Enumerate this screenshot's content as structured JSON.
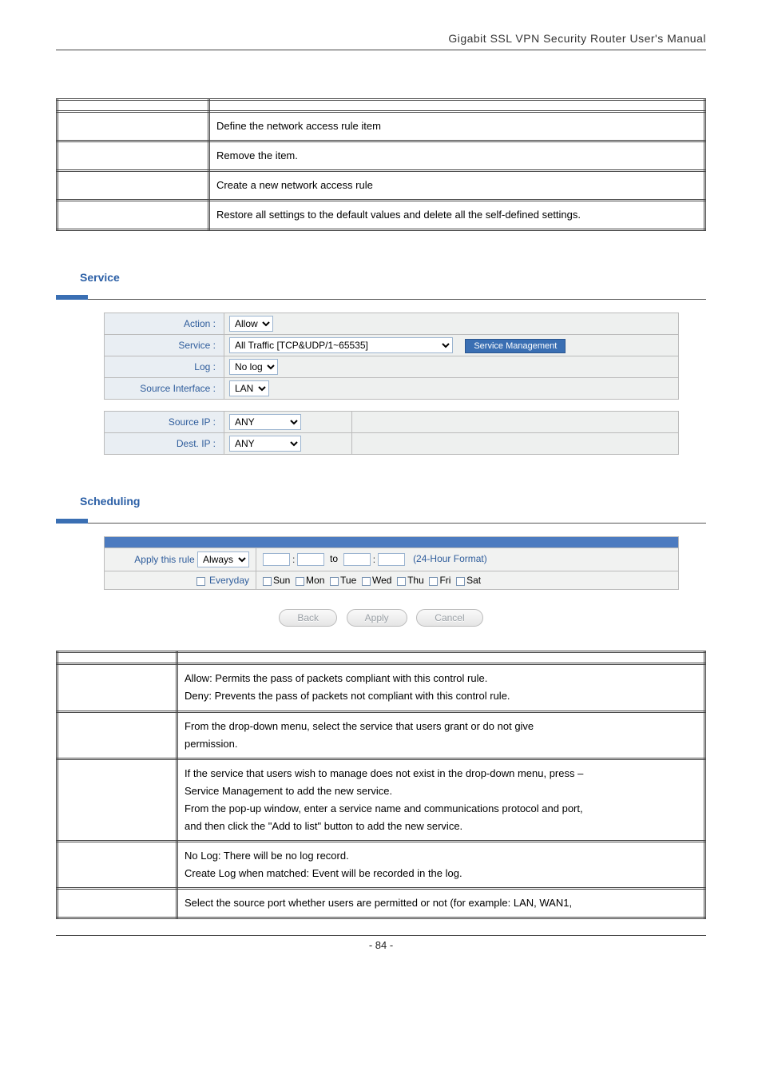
{
  "header": {
    "title": "Gigabit SSL VPN Security Router User's Manual"
  },
  "table1": {
    "rows": [
      {
        "label": "",
        "desc": "Define the network access rule item"
      },
      {
        "label": "",
        "desc": "Remove the item."
      },
      {
        "label": "",
        "desc": "Create a new network access rule"
      },
      {
        "label": "",
        "desc": "Restore all settings to the default values and delete all the self-defined settings."
      }
    ]
  },
  "service": {
    "title": "Service",
    "rows": {
      "action": {
        "label": "Action :",
        "value": "Allow"
      },
      "service": {
        "label": "Service :",
        "value": "All Traffic [TCP&UDP/1~65535]",
        "button": "Service Management"
      },
      "log": {
        "label": "Log :",
        "value": "No log"
      },
      "src_if": {
        "label": "Source Interface :",
        "value": "LAN"
      },
      "src_ip": {
        "label": "Source IP :",
        "value": "ANY"
      },
      "dest_ip": {
        "label": "Dest. IP :",
        "value": "ANY"
      }
    }
  },
  "scheduling": {
    "title": "Scheduling",
    "apply_label": "Apply this rule",
    "apply_value": "Always",
    "to": "to",
    "format_note": "(24-Hour Format)",
    "everyday": "Everyday",
    "days": [
      "Sun",
      "Mon",
      "Tue",
      "Wed",
      "Thu",
      "Fri",
      "Sat"
    ]
  },
  "buttons": {
    "back": "Back",
    "apply": "Apply",
    "cancel": "Cancel"
  },
  "table2": {
    "rows": [
      {
        "desc": "Allow: Permits the pass of packets compliant with this control rule.\nDeny: Prevents the pass of packets not compliant with this control rule."
      },
      {
        "desc": "From the drop-down menu, select the service that users grant or do not give permission."
      },
      {
        "desc": "If the service that users wish to manage does not exist in the drop-down menu, press – Service Management to add the new service.\nFrom the pop-up window, enter a service name and communications protocol and port, and then click the \"Add to list\" button to add the new service."
      },
      {
        "desc": "No Log: There will be no log record.\nCreate Log when matched: Event will be recorded in the log."
      },
      {
        "desc": "Select the source port whether users are permitted or not (for example: LAN, WAN1,"
      }
    ]
  },
  "footer": {
    "page": "- 84 -"
  }
}
